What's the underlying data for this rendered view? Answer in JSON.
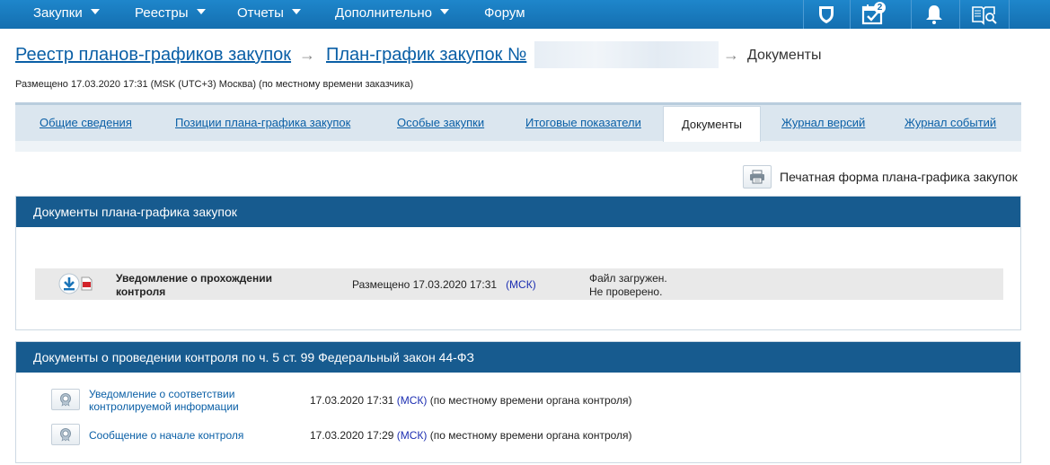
{
  "topnav": {
    "items": [
      {
        "label": "Закупки",
        "has_caret": true
      },
      {
        "label": "Реестры",
        "has_caret": true
      },
      {
        "label": "Отчеты",
        "has_caret": true
      },
      {
        "label": "Дополнительно",
        "has_caret": true
      },
      {
        "label": "Форум",
        "has_caret": false
      }
    ],
    "icons": [
      "shield-icon",
      "calendar-check-icon",
      "bell-icon",
      "book-search-icon"
    ],
    "calendar_badge": "2",
    "bg_color": "#1a7ec2"
  },
  "breadcrumb": {
    "registry_link": "Реестр планов-графиков закупок",
    "plan_link": "План-график закупок №",
    "current": "Документы"
  },
  "posted_info": "Размещено 17.03.2020 17:31 (MSK (UTC+3) Москва) (по местному времени заказчика)",
  "tabs": {
    "general": "Общие сведения",
    "positions": "Позиции плана-графика закупок",
    "special": "Особые закупки",
    "totals": "Итоговые показатели",
    "documents": "Документы",
    "versions": "Журнал версий",
    "events": "Журнал событий"
  },
  "print": {
    "label": "Печатная форма плана-графика закупок"
  },
  "plan_docs": {
    "header": "Документы плана-графика закупок",
    "doc": {
      "title": "Уведомление о прохождении контроля",
      "posted_prefix": "Размещено 17.03.2020 17:31",
      "tz": "(МСК)",
      "status_line1": "Файл загружен.",
      "status_line2": "Не проверено."
    }
  },
  "control_docs": {
    "header": "Документы о проведении контроля по ч. 5 ст. 99 Федеральный закон 44-ФЗ",
    "items": [
      {
        "title": "Уведомление о соответствии контролируемой информации",
        "date": "17.03.2020 17:31",
        "tz": "(МСК)",
        "note": "(по местному времени органа контроля)"
      },
      {
        "title": "Сообщение о начале контроля",
        "date": "17.03.2020 17:29",
        "tz": "(МСК)",
        "note": "(по местному времени органа контроля)"
      }
    ]
  },
  "colors": {
    "panel_header": "#175b8f",
    "link": "#0a5fa6",
    "tz": "#1d2fb2"
  }
}
